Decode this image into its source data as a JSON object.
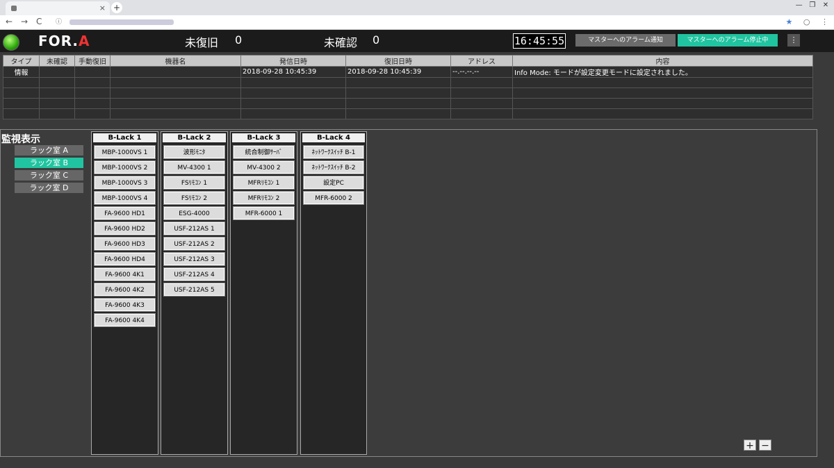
{
  "browser": {
    "tab_close": "×",
    "new_tab": "+",
    "nav_back": "←",
    "nav_forward": "→",
    "nav_reload": "C",
    "info": "ⓘ",
    "star": "★",
    "win_min": "—",
    "win_max": "❐",
    "win_close": "✕"
  },
  "header": {
    "logo": "FOR.",
    "logo_mark": "A",
    "unrecovered_label": "未復旧",
    "unrecovered_count": "0",
    "unconfirmed_label": "未確認",
    "unconfirmed_count": "0",
    "clock": "16:45:55",
    "notify_button": "マスターへのアラーム通知",
    "stop_button": "マスターへのアラーム停止中",
    "menu_icon": "⋮",
    "led_color": "#2ea80c"
  },
  "alarm_table": {
    "columns": [
      "タイプ",
      "未確認",
      "手動復旧",
      "機器名",
      "発信日時",
      "復旧日時",
      "アドレス",
      "内容"
    ],
    "rows": [
      [
        "情報",
        "",
        "",
        "",
        "2018-09-28 10:45:39",
        "2018-09-28 10:45:39",
        "--.--.--.--",
        "Info Mode: モードが設定変更モードに設定されました。"
      ],
      [
        "",
        "",
        "",
        "",
        "",
        "",
        "",
        ""
      ],
      [
        "",
        "",
        "",
        "",
        "",
        "",
        "",
        ""
      ],
      [
        "",
        "",
        "",
        "",
        "",
        "",
        "",
        ""
      ],
      [
        "",
        "",
        "",
        "",
        "",
        "",
        "",
        ""
      ]
    ]
  },
  "monitor": {
    "title": "監視表示",
    "rooms": [
      {
        "label": "ラック室 A",
        "active": false
      },
      {
        "label": "ラック室 B",
        "active": true
      },
      {
        "label": "ラック室 C",
        "active": false
      },
      {
        "label": "ラック室 D",
        "active": false
      }
    ],
    "racks": [
      {
        "name": "B-Lack 1",
        "devices": [
          "MBP-1000VS 1",
          "MBP-1000VS 2",
          "MBP-1000VS 3",
          "MBP-1000VS 4",
          "FA-9600 HD1",
          "FA-9600 HD2",
          "FA-9600 HD3",
          "FA-9600 HD4",
          "FA-9600 4K1",
          "FA-9600 4K2",
          "FA-9600 4K3",
          "FA-9600 4K4"
        ]
      },
      {
        "name": "B-Lack 2",
        "devices": [
          "波形ﾓﾆﾀ",
          "MV-4300 1",
          "FSﾘﾓｺﾝ 1",
          "FSﾘﾓｺﾝ 2",
          "ESG-4000",
          "USF-212AS 1",
          "USF-212AS 2",
          "USF-212AS 3",
          "USF-212AS 4",
          "USF-212AS 5"
        ]
      },
      {
        "name": "B-Lack 3",
        "devices": [
          "統合制御ｻｰﾊﾞ",
          "MV-4300 2",
          "MFRﾘﾓｺﾝ 1",
          "MFRﾘﾓｺﾝ 2",
          "MFR-6000 1"
        ]
      },
      {
        "name": "B-Lack 4",
        "devices": [
          "ﾈｯﾄﾜｰｸｽｲｯﾁ B-1",
          "ﾈｯﾄﾜｰｸｽｲｯﾁ B-2",
          "設定PC",
          "MFR-6000 2"
        ]
      }
    ],
    "zoom_in": "+",
    "zoom_out": "−",
    "accent": "#21c4a0"
  }
}
